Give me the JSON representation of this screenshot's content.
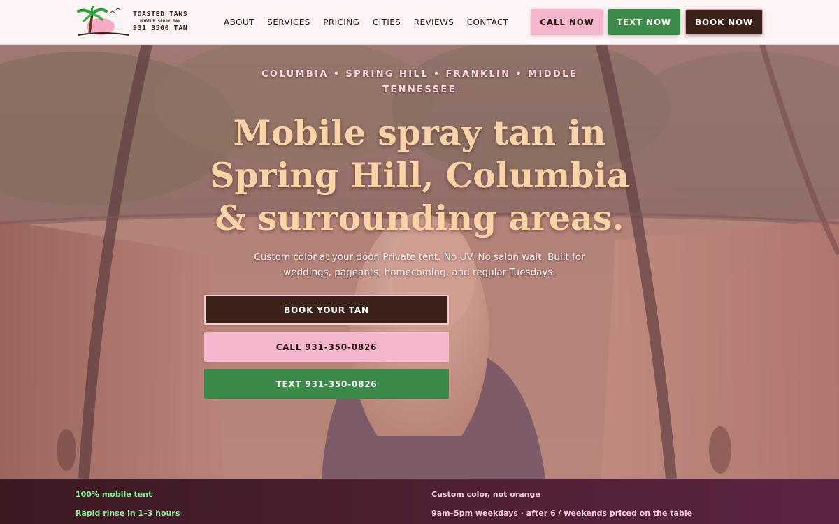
{
  "brand": {
    "name": "TOASTED TANS",
    "tagline": "MOBILE SPRAY TAN",
    "phone_art": "931 3500 TAN"
  },
  "nav": {
    "links": [
      "ABOUT",
      "SERVICES",
      "PRICING",
      "CITIES",
      "REVIEWS",
      "CONTACT"
    ],
    "call_label": "CALL NOW",
    "text_label": "TEXT NOW",
    "book_label": "BOOK NOW"
  },
  "hero": {
    "eyebrow": "COLUMBIA • SPRING HILL • FRANKLIN • MIDDLE TENNESSEE",
    "title": "Mobile spray tan in Spring Hill, Columbia & surrounding areas.",
    "subtitle": "Custom color at your door. Private tent. No UV. No salon wait. Built for weddings, pageants, homecoming, and regular Tuesdays.",
    "book_button": "BOOK YOUR TAN",
    "call_button": "CALL 931-350-0826",
    "text_button": "TEXT 931-350-0826"
  },
  "features": {
    "left": [
      "100% mobile tent",
      "Rapid rinse in 1–3 hours"
    ],
    "right": [
      "Custom color, not orange",
      "9am–5pm weekdays · after 6 / weekends priced on the table"
    ]
  },
  "colors": {
    "brand_pink": "#f4b6cd",
    "brand_green": "#3d8a4a",
    "brand_brown": "#3a2218",
    "title_peach": "#fbd3a6",
    "feature_green": "#7ef08c"
  }
}
